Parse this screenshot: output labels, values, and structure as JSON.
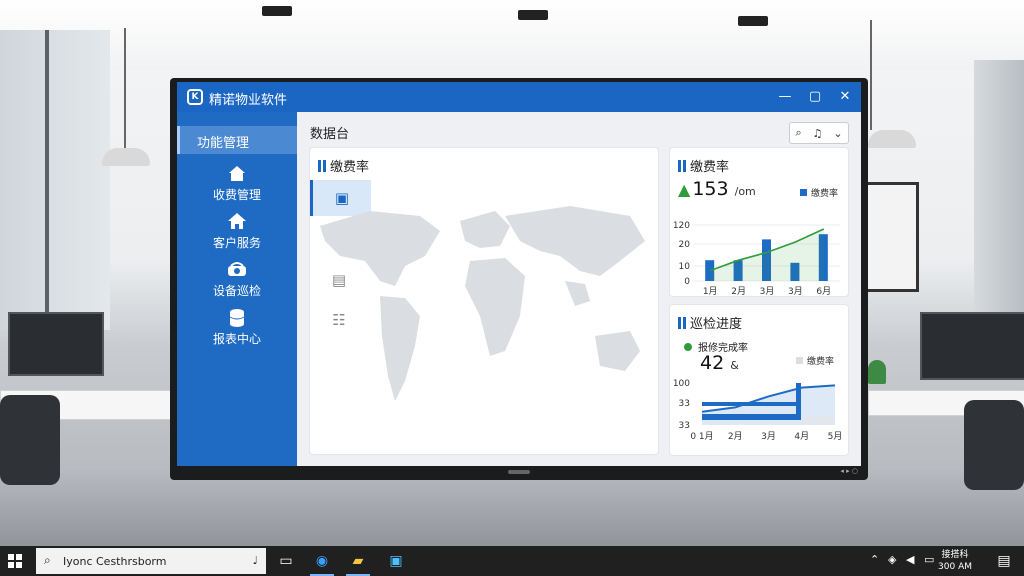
{
  "app": {
    "logo": "K",
    "title": "精诺物业软件",
    "minimize": "—",
    "restore": "▢",
    "close": "✕"
  },
  "sidebar": {
    "header": "功能管理",
    "items": [
      {
        "label": "收费管理",
        "icon": "home-icon"
      },
      {
        "label": "客户服务",
        "icon": "house-icon"
      },
      {
        "label": "设备巡检",
        "icon": "device-icon"
      },
      {
        "label": "报表中心",
        "icon": "database-icon"
      }
    ]
  },
  "main": {
    "title": "数据台",
    "tools": {
      "search": "search-icon",
      "notify": "bell-icon",
      "dropdown": "chevron-down-icon"
    }
  },
  "map_card": {
    "title": "缴费率",
    "tools": [
      "calendar-icon",
      "house-icon",
      "building-icon",
      "list-icon"
    ]
  },
  "stat_card_1": {
    "title": "缴费率",
    "value": "153",
    "unit": "/om",
    "legend": "缴费率",
    "colors": {
      "bar": "#1e6bc6",
      "line": "#2e9b3c",
      "accent": "#1c66c3"
    }
  },
  "stat_card_2": {
    "title": "巡检进度",
    "subtitle": "报修完成率",
    "value": "42",
    "value_suffix": "&",
    "legend": "缴费率"
  },
  "chart_data": [
    {
      "type": "bar",
      "title": "缴费率",
      "categories": [
        "1月",
        "2月",
        "3月",
        "3月",
        "6月"
      ],
      "y_ticks": [
        "0",
        "10",
        "20",
        "120"
      ],
      "series": [
        {
          "name": "缴费率",
          "type": "bar",
          "values": [
            8,
            8,
            16,
            7,
            18
          ]
        },
        {
          "name": "",
          "type": "line",
          "values": [
            4,
            8,
            11,
            15,
            20
          ]
        }
      ]
    },
    {
      "type": "area",
      "title": "巡检进度",
      "categories": [
        "0 1月",
        "2月",
        "3月",
        "4月",
        "5月"
      ],
      "y_ticks": [
        "33",
        "33",
        "100"
      ],
      "series": [
        {
          "name": "缴费率",
          "values": [
            36,
            38,
            43,
            47,
            48
          ]
        }
      ]
    }
  ],
  "taskbar": {
    "search_text": "Iyonc Cesthrsborm",
    "tray_lines": [
      "接搭科",
      "300 AM"
    ]
  }
}
